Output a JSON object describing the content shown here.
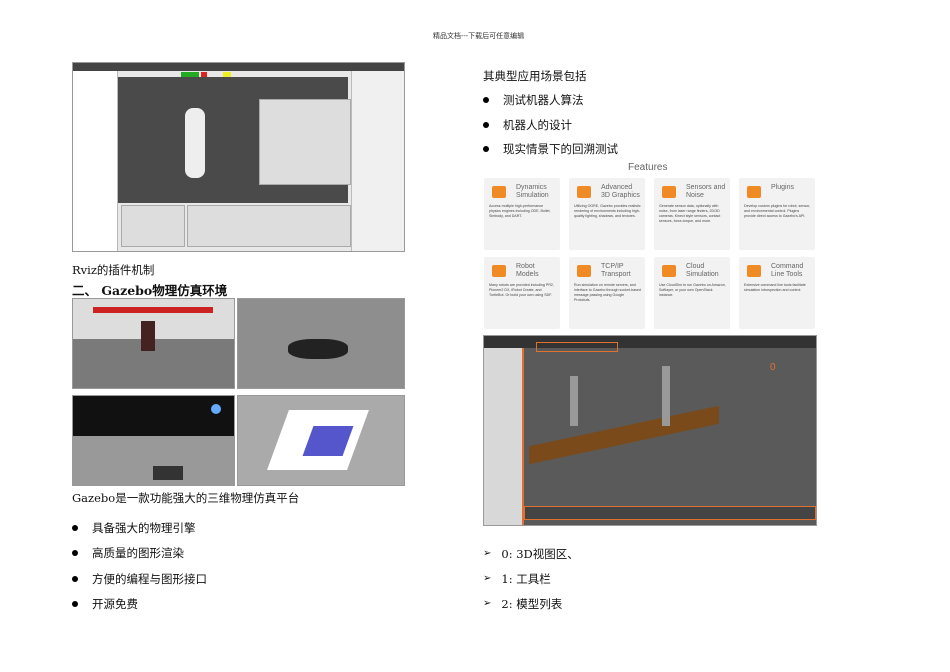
{
  "header": "精品文档---下载后可任意编辑",
  "left": {
    "caption_rviz": "Rviz的插件机制",
    "section_heading": "二、 Gazebo物理仿真环境",
    "intro": "Gazebo是一款功能强大的三维物理仿真平台",
    "bullets": [
      "具备强大的物理引擎",
      "高质量的图形渲染",
      "方便的编程与图形接口",
      "开源免费"
    ]
  },
  "right": {
    "intro": "其典型应用场景包括",
    "bullets": [
      "测试机器人算法",
      "机器人的设计",
      "现实情景下的回溯测试"
    ],
    "features": {
      "title": "Features",
      "cards": [
        {
          "title": "Dynamics Simulation",
          "desc": "Access multiple high-performance physics engines including ODE, Bullet, Simbody, and DART."
        },
        {
          "title": "Advanced 3D Graphics",
          "desc": "Utilizing OGRE, Gazebo provides realistic rendering of environments including high-quality lighting, shadows, and textures."
        },
        {
          "title": "Sensors and Noise",
          "desc": "Generate sensor data, optionally with noise, from laser range finders, 2D/3D cameras, Kinect style sensors, contact sensors, force-torque, and more."
        },
        {
          "title": "Plugins",
          "desc": "Develop custom plugins for robot, sensor, and environmental control. Plugins provide direct access to Gazebo's API."
        },
        {
          "title": "Robot Models",
          "desc": "Many robots are provided including PR2, Pioneer2 DX, iRobot Create, and TurtleBot. Or build your own using SDF."
        },
        {
          "title": "TCP/IP Transport",
          "desc": "Run simulation on remote servers, and interface to Gazebo through socket-based message passing using Google Protobufs."
        },
        {
          "title": "Cloud Simulation",
          "desc": "Use CloudSim to run Gazebo on Amazon, Softlayer, or your own OpenStack instance."
        },
        {
          "title": "Command Line Tools",
          "desc": "Extensive command line tools facilitate simulation introspection and control."
        }
      ]
    },
    "list": [
      "0: 3D视图区、",
      "1:  工具栏",
      "2:  模型列表"
    ],
    "accent": "#f08a24"
  }
}
